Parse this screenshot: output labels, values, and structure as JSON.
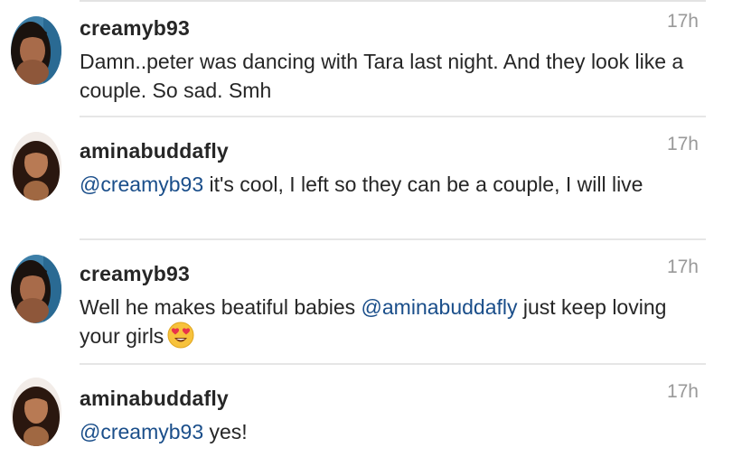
{
  "comments": [
    {
      "username": "creamyb93",
      "time": "17h",
      "text": "Damn..peter was dancing with Tara last night. And they look like a couple. So sad. Smh"
    },
    {
      "username": "aminabuddafly",
      "time": "17h",
      "mention": "@creamyb93",
      "text": " it's cool, I left so they can be a couple, I will live"
    },
    {
      "username": "creamyb93",
      "time": "17h",
      "text_before": "Well he makes beatiful babies ",
      "mention": "@aminabuddafly",
      "text_after": " just keep loving your girls",
      "emoji": "heart-eyes-emoji"
    },
    {
      "username": "aminabuddafly",
      "time": "17h",
      "mention": "@creamyb93",
      "text": " yes!"
    }
  ],
  "colors": {
    "mention": "#1a4e8a",
    "username": "#262626",
    "timestamp": "#999999",
    "divider": "#e6e6e6"
  }
}
